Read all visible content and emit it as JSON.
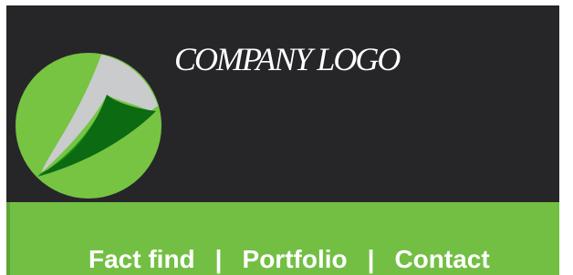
{
  "header": {
    "logo_text": "COMPANY LOGO",
    "logo_icon": "leaf-swoosh-icon",
    "background_color": "#262629"
  },
  "nav": {
    "background_color": "#73bf44",
    "separator": "|",
    "items": [
      {
        "label": "Fact find"
      },
      {
        "label": "Portfolio"
      },
      {
        "label": "Contact"
      }
    ]
  }
}
